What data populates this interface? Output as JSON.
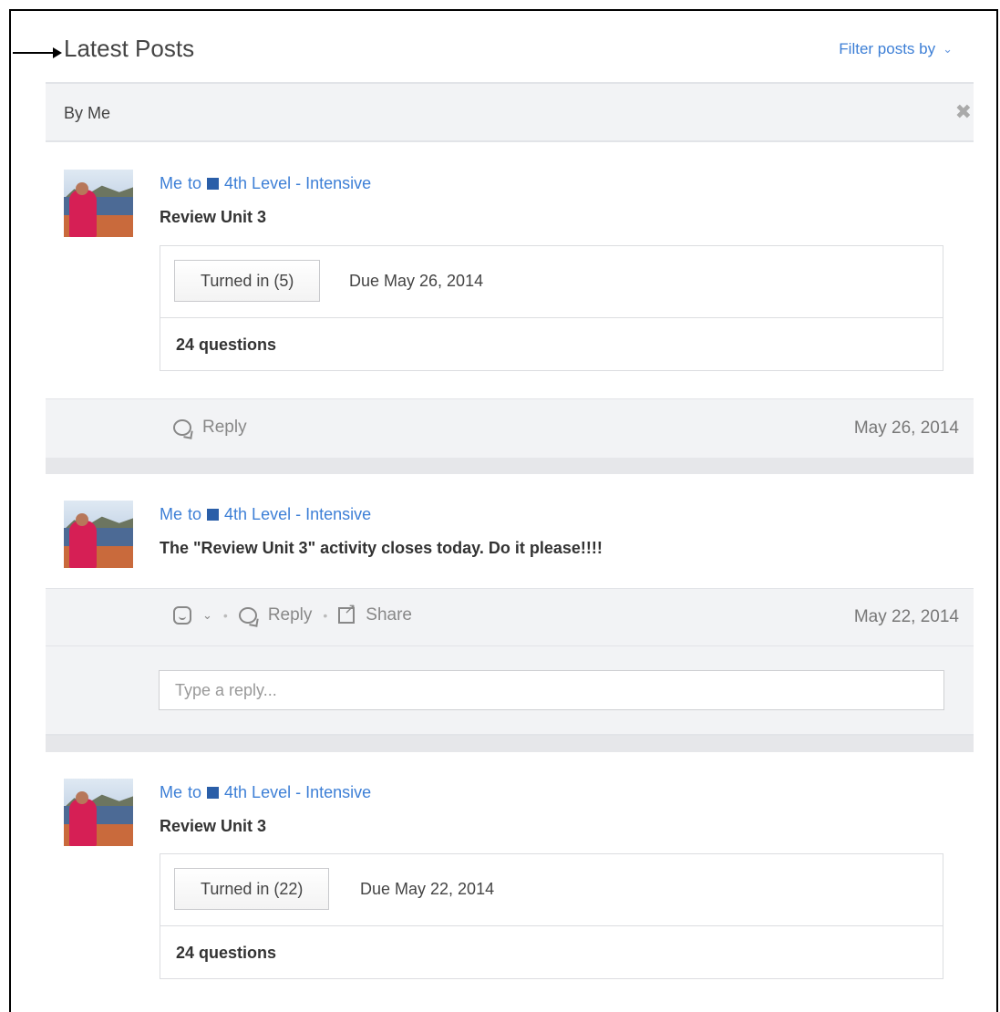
{
  "header": {
    "title": "Latest Posts",
    "filter_label": "Filter posts by",
    "filter_icon": "chevron-down-icon"
  },
  "filter_bar": {
    "label": "By Me",
    "close_icon": "close-icon"
  },
  "posts": [
    {
      "author": "Me",
      "to": "to",
      "group": "4th Level - Intensive",
      "text": "Review Unit 3",
      "turned_in": "Turned in (5)",
      "due": "Due May 26, 2014",
      "questions": "24 questions",
      "reply_label": "Reply",
      "date": "May 26, 2014"
    },
    {
      "author": "Me",
      "to": "to",
      "group": "4th Level - Intensive",
      "text": "The \"Review Unit 3\" activity closes today. Do it please!!!!",
      "reply_label": "Reply",
      "share_label": "Share",
      "date": "May 22, 2014",
      "reply_placeholder": "Type a reply..."
    },
    {
      "author": "Me",
      "to": "to",
      "group": "4th Level - Intensive",
      "text": "Review Unit 3",
      "turned_in": "Turned in (22)",
      "due": "Due May 22, 2014",
      "questions": "24 questions"
    }
  ],
  "colors": {
    "link": "#3d7fd6",
    "group_square": "#2a5ea8",
    "panel_bg": "#f2f3f5"
  }
}
